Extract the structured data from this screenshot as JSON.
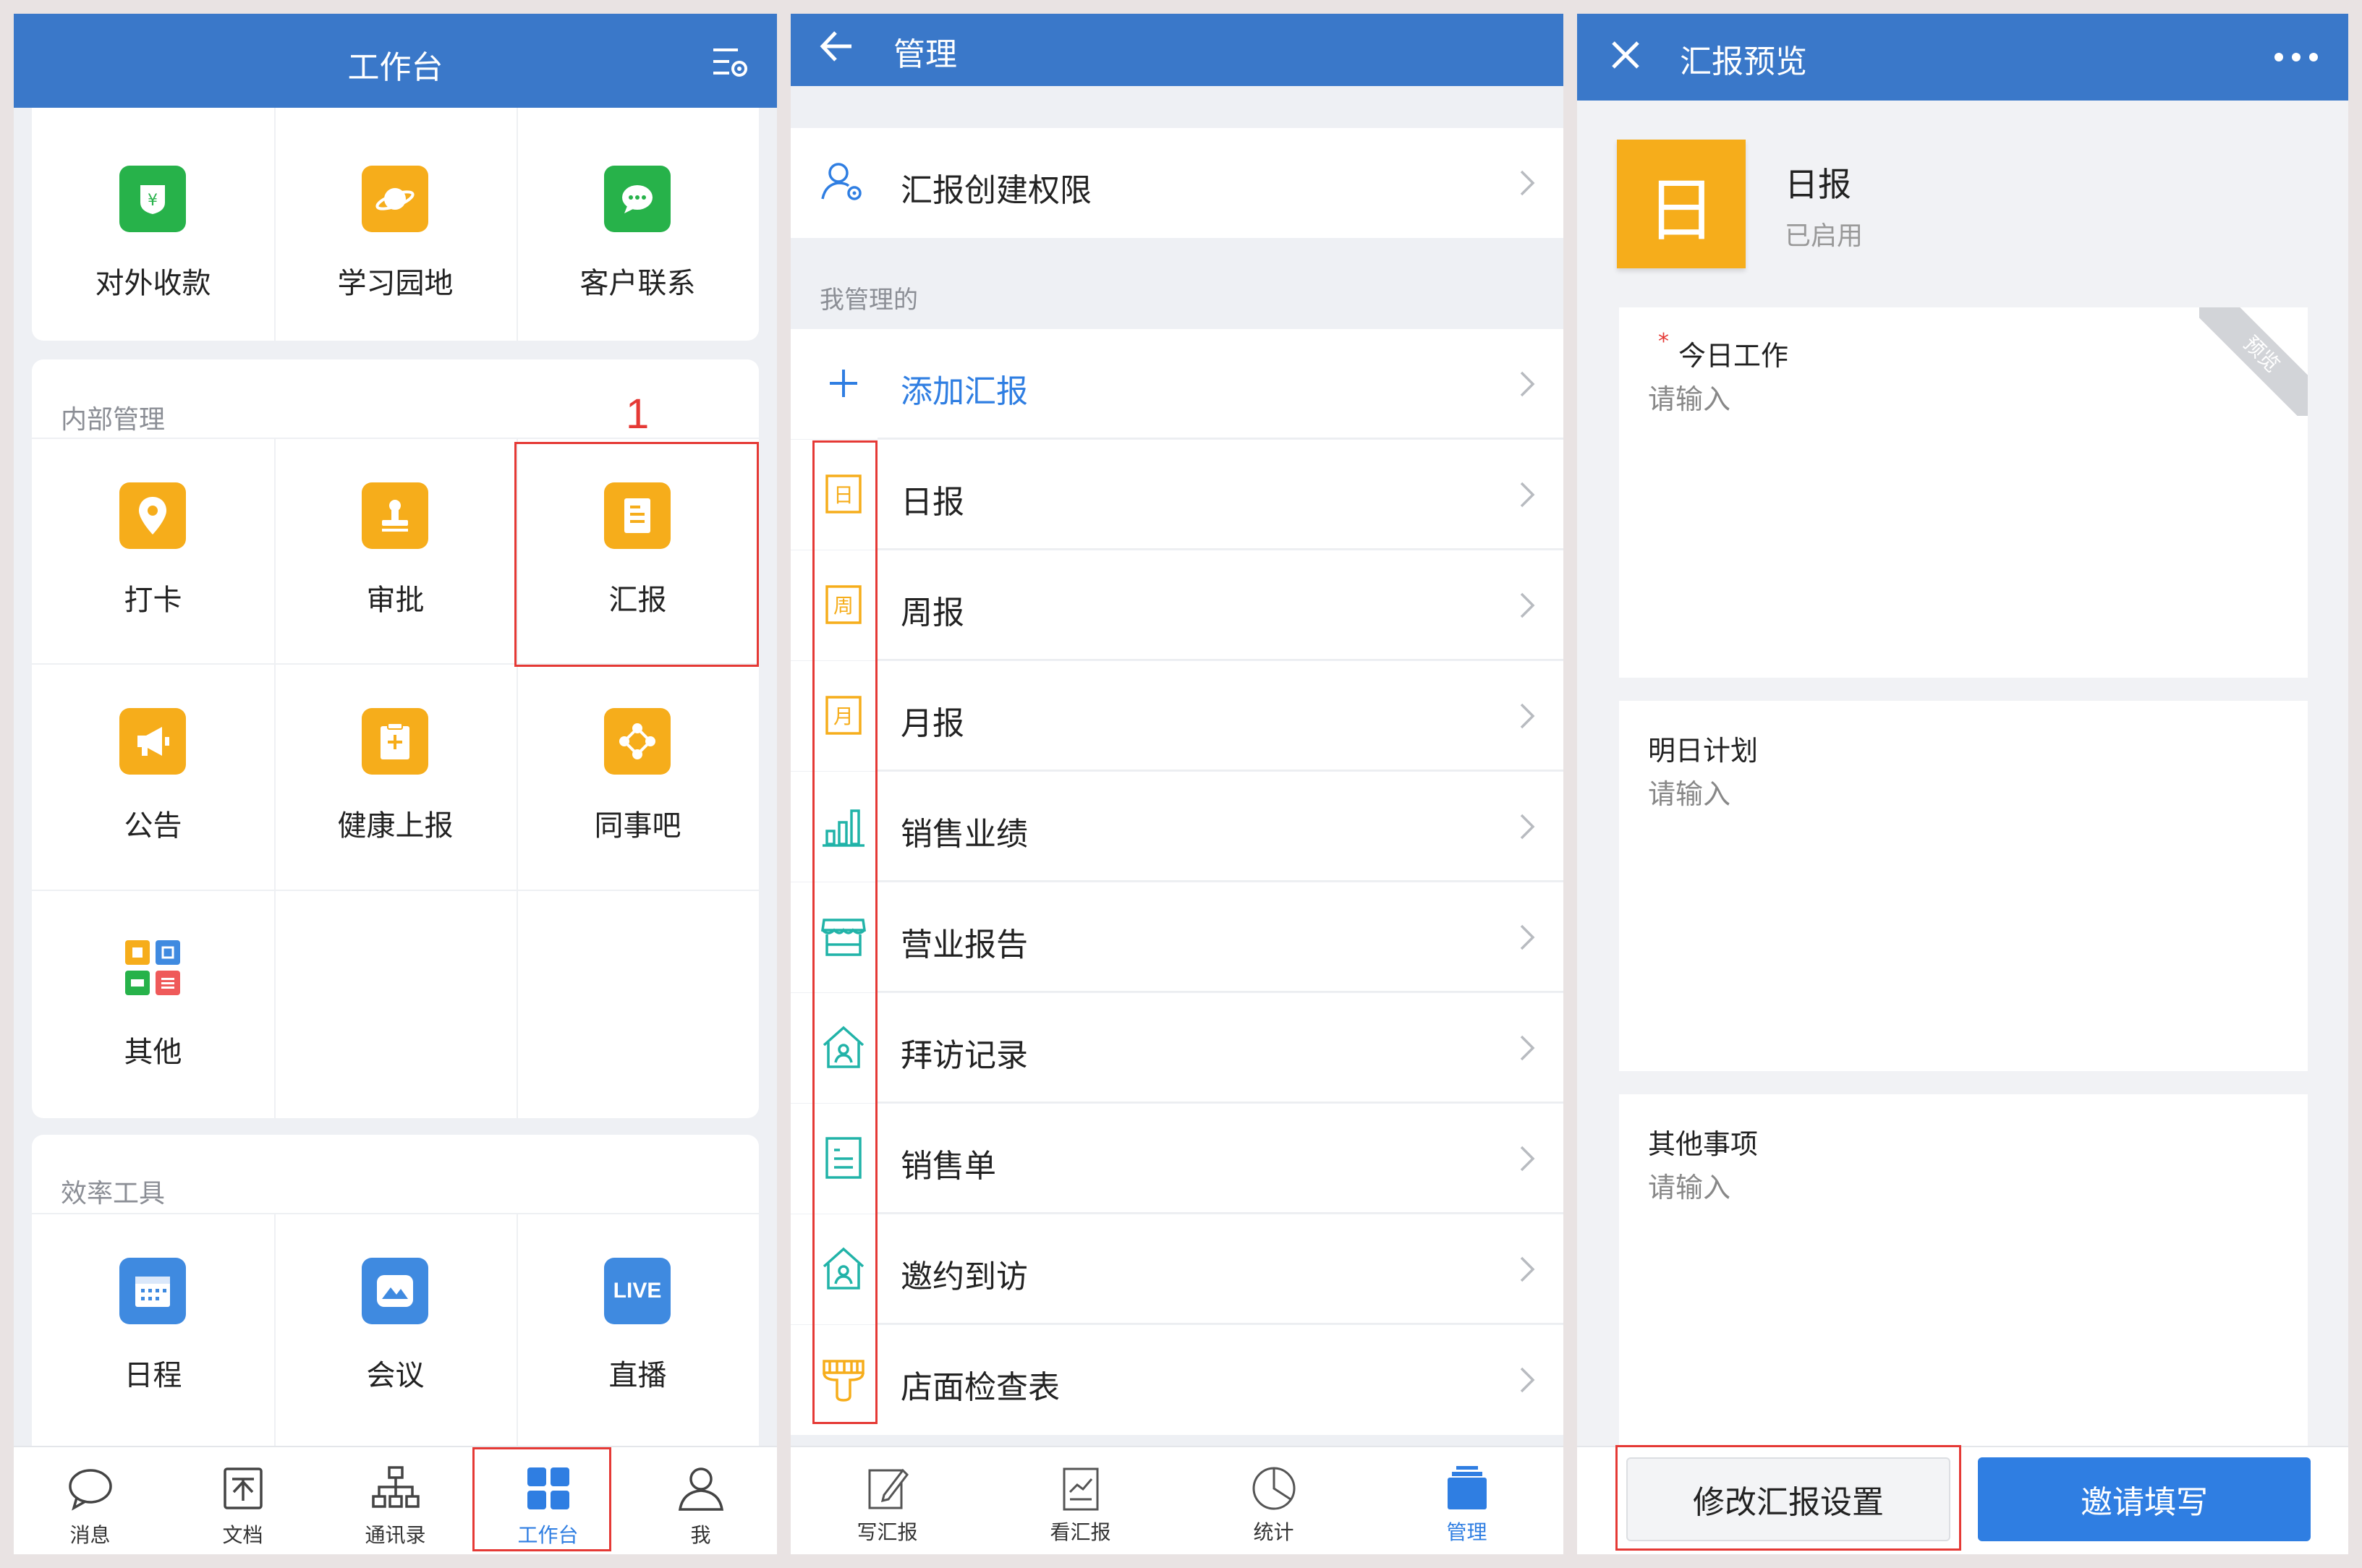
{
  "panel1": {
    "title": "工作台",
    "top_apps": [
      {
        "label": "对外收款",
        "icon": "payment-icon",
        "color": "#27b24a"
      },
      {
        "label": "学习园地",
        "icon": "planet-icon",
        "color": "#f6ad1b"
      },
      {
        "label": "客户联系",
        "icon": "chat-bubble-icon",
        "color": "#27b24a"
      }
    ],
    "internal": {
      "title": "内部管理",
      "apps": [
        {
          "label": "打卡",
          "icon": "location-pin-icon",
          "color": "#f6ad1b"
        },
        {
          "label": "审批",
          "icon": "stamp-icon",
          "color": "#f6ad1b"
        },
        {
          "label": "汇报",
          "icon": "report-doc-icon",
          "color": "#f6ad1b"
        },
        {
          "label": "公告",
          "icon": "megaphone-icon",
          "color": "#f6ad1b"
        },
        {
          "label": "健康上报",
          "icon": "health-clipboard-icon",
          "color": "#f6ad1b"
        },
        {
          "label": "同事吧",
          "icon": "network-icon",
          "color": "#f6ad1b"
        },
        {
          "label": "其他",
          "icon": "app-grid-icon",
          "color": "#ffffff"
        }
      ]
    },
    "efficiency": {
      "title": "效率工具",
      "apps": [
        {
          "label": "日程",
          "icon": "calendar-icon",
          "color": "#3f8ae0"
        },
        {
          "label": "会议",
          "icon": "meeting-icon",
          "color": "#3f8ae0"
        },
        {
          "label": "直播",
          "icon": "live-icon",
          "color": "#3f8ae0",
          "badge": "LIVE"
        }
      ]
    },
    "annotation": "1",
    "tabs": [
      {
        "label": "消息",
        "icon": "message-icon",
        "active": false
      },
      {
        "label": "文档",
        "icon": "document-icon",
        "active": false
      },
      {
        "label": "通讯录",
        "icon": "contacts-icon",
        "active": false
      },
      {
        "label": "工作台",
        "icon": "workbench-icon",
        "active": true
      },
      {
        "label": "我",
        "icon": "profile-icon",
        "active": false
      }
    ]
  },
  "panel2": {
    "title": "管理",
    "permission_label": "汇报创建权限",
    "section_label": "我管理的",
    "add_label": "添加汇报",
    "items": [
      {
        "label": "日报",
        "icon": "daily-icon",
        "glyph": "日",
        "color": "#f6ad1b"
      },
      {
        "label": "周报",
        "icon": "weekly-icon",
        "glyph": "周",
        "color": "#f6ad1b"
      },
      {
        "label": "月报",
        "icon": "monthly-icon",
        "glyph": "月",
        "color": "#f6ad1b"
      },
      {
        "label": "销售业绩",
        "icon": "bar-chart-icon",
        "color": "#21b3a8"
      },
      {
        "label": "营业报告",
        "icon": "storefront-icon",
        "color": "#21b3a8"
      },
      {
        "label": "拜访记录",
        "icon": "house-user-icon",
        "color": "#21b3a8"
      },
      {
        "label": "销售单",
        "icon": "list-doc-icon",
        "color": "#21b3a8"
      },
      {
        "label": "邀约到访",
        "icon": "house-user-icon",
        "color": "#21b3a8"
      },
      {
        "label": "店面检查表",
        "icon": "brush-icon",
        "color": "#f6ad1b"
      }
    ],
    "tabs": [
      {
        "label": "写汇报",
        "icon": "write-report-icon",
        "active": false
      },
      {
        "label": "看汇报",
        "icon": "view-report-icon",
        "active": false
      },
      {
        "label": "统计",
        "icon": "pie-chart-icon",
        "active": false
      },
      {
        "label": "管理",
        "icon": "manage-icon",
        "active": true
      }
    ]
  },
  "panel3": {
    "title": "汇报预览",
    "report_glyph": "日",
    "report_name": "日报",
    "report_status": "已启用",
    "ribbon": "预览",
    "required_mark": "*",
    "fields": [
      {
        "label": "今日工作",
        "placeholder": "请输入",
        "required": true
      },
      {
        "label": "明日计划",
        "placeholder": "请输入",
        "required": false
      },
      {
        "label": "其他事项",
        "placeholder": "请输入",
        "required": false
      }
    ],
    "btn_settings": "修改汇报设置",
    "btn_invite": "邀请填写"
  },
  "colors": {
    "brand": "#3a78c9",
    "accent_blue": "#2f7ee2",
    "warning_orange": "#f6ad1b",
    "teal": "#21b3a8",
    "annotation_red": "#e53935"
  }
}
